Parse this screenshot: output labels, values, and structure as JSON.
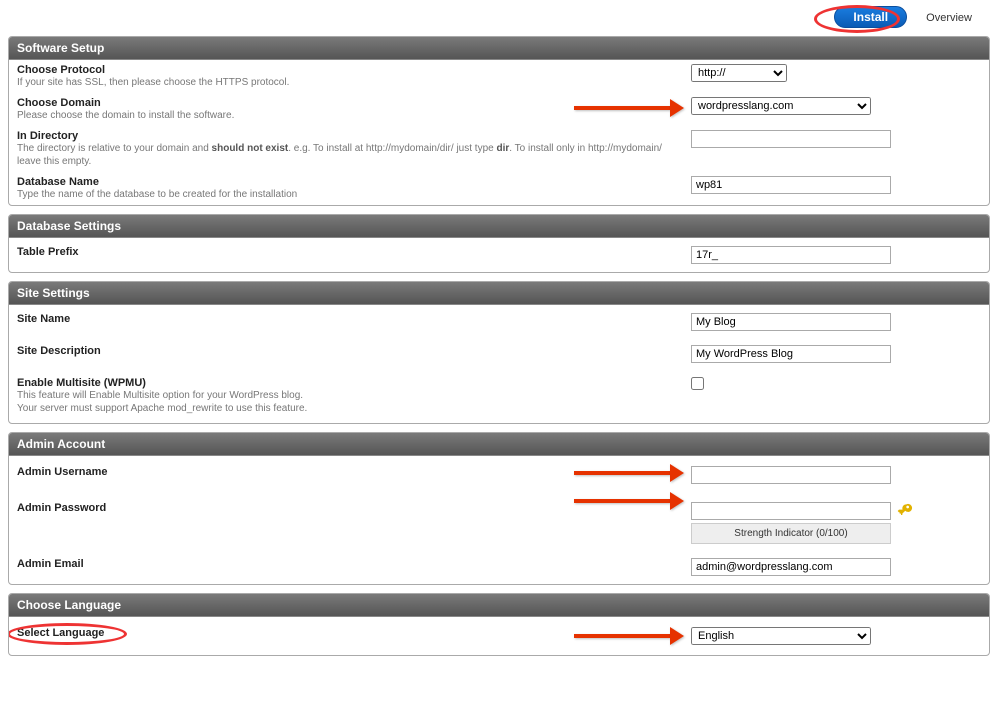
{
  "tabs": {
    "install": "Install",
    "overview": "Overview"
  },
  "sections": {
    "software_setup": {
      "title": "Software Setup",
      "protocol": {
        "label": "Choose Protocol",
        "desc": "If your site has SSL, then please choose the HTTPS protocol.",
        "value": "http://"
      },
      "domain": {
        "label": "Choose Domain",
        "desc": "Please choose the domain to install the software.",
        "value": "wordpresslang.com"
      },
      "directory": {
        "label": "In Directory",
        "desc_a": "The directory is relative to your domain and ",
        "desc_b": "should not exist",
        "desc_c": ". e.g. To install at http://mydomain/dir/ just type ",
        "desc_d": "dir",
        "desc_e": ". To install only in http://mydomain/ leave this empty.",
        "value": ""
      },
      "dbname": {
        "label": "Database Name",
        "desc": "Type the name of the database to be created for the installation",
        "value": "wp81"
      }
    },
    "database_settings": {
      "title": "Database Settings",
      "prefix": {
        "label": "Table Prefix",
        "value": "17r_"
      }
    },
    "site_settings": {
      "title": "Site Settings",
      "site_name": {
        "label": "Site Name",
        "value": "My Blog"
      },
      "site_desc": {
        "label": "Site Description",
        "value": "My WordPress Blog"
      },
      "multisite": {
        "label": "Enable Multisite (WPMU)",
        "desc1": "This feature will Enable Multisite option for your WordPress blog.",
        "desc2": "Your server must support Apache mod_rewrite to use this feature."
      }
    },
    "admin_account": {
      "title": "Admin Account",
      "username": {
        "label": "Admin Username",
        "value": ""
      },
      "password": {
        "label": "Admin Password",
        "value": "",
        "strength": "Strength Indicator (0/100)"
      },
      "email": {
        "label": "Admin Email",
        "value": "admin@wordpresslang.com"
      }
    },
    "choose_language": {
      "title": "Choose Language",
      "select": {
        "label": "Select Language",
        "value": "English"
      }
    }
  }
}
